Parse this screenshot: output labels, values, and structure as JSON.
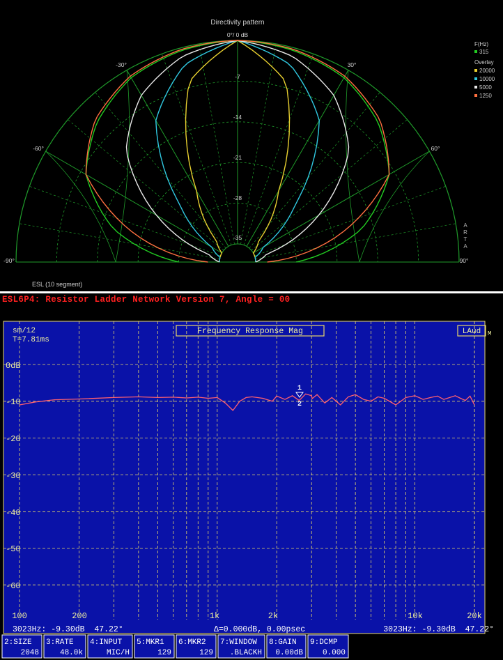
{
  "colors": {
    "polar_grid": "#1f9b2a",
    "fr_background": "#0a12a8",
    "fr_grid": "#e8d86a",
    "fr_trace": "#ff6070",
    "header_text": "#ff2020"
  },
  "polar": {
    "title": "Directivity pattern",
    "top_label": "0°/ 0 dB",
    "bottom_left_label": "ESL (10 segment)",
    "watermark": "ARTA",
    "radial_ticks": [
      "-7",
      "-14",
      "-21",
      "-28",
      "-35"
    ],
    "angle_labels": {
      "neg30": "-30°",
      "pos30": "30°",
      "neg60": "-60°",
      "pos60": "60°",
      "neg90": "-90°",
      "pos90": "90°"
    },
    "legend": {
      "freq_header": "F(Hz)",
      "main": {
        "label": "315",
        "color": "#22cc22"
      },
      "overlay_header": "Overlay",
      "overlays": [
        {
          "label": "20000",
          "color": "#e8d030"
        },
        {
          "label": "10000",
          "color": "#30c8e0"
        },
        {
          "label": "5000",
          "color": "#e8e8e8"
        },
        {
          "label": "1250",
          "color": "#ff7040"
        }
      ]
    }
  },
  "chart_data": [
    {
      "type": "line",
      "title": "Directivity pattern",
      "angle_range_deg": [
        -90,
        90
      ],
      "rlim_db": [
        -35,
        0
      ],
      "radial_ticks_db": [
        0,
        -7,
        -14,
        -21,
        -28,
        -35
      ],
      "angles_deg": [
        0,
        15,
        30,
        45,
        60,
        75,
        90
      ],
      "series": [
        {
          "name": "315",
          "values_db": [
            0,
            -0.5,
            -1.5,
            -4,
            -8,
            -16,
            -28
          ],
          "symmetric": true
        },
        {
          "name": "20000",
          "values_db": [
            0,
            -6,
            -24,
            -33,
            -35,
            -35,
            -35
          ],
          "symmetric": true
        },
        {
          "name": "10000",
          "values_db": [
            0,
            -3,
            -10,
            -24,
            -33,
            -35,
            -35
          ],
          "symmetric": true
        },
        {
          "name": "5000",
          "values_db": [
            0,
            -1.5,
            -5,
            -11,
            -22,
            -33,
            -35
          ],
          "symmetric": true
        },
        {
          "name": "1250",
          "values_db": [
            0,
            -0.3,
            -1.2,
            -3.5,
            -8,
            -20,
            -33
          ],
          "symmetric": true
        }
      ]
    },
    {
      "type": "line",
      "title": "Frequency Response Mag",
      "xscale": "log",
      "xlim": [
        100,
        20000
      ],
      "ylim": [
        -70,
        0
      ],
      "x_ticks": [
        "100",
        "200",
        "1k",
        "2k",
        "10k",
        "20k"
      ],
      "y_ticks": [
        "0dB",
        "-10",
        "-20",
        "-30",
        "-40",
        "-50",
        "-60"
      ],
      "series": [
        {
          "x": [
            100,
            120,
            150,
            200,
            300,
            400,
            500,
            600,
            700,
            800,
            900,
            1000,
            1100,
            1200,
            1300,
            1400,
            1500,
            1700,
            1900,
            2000,
            2200,
            2400,
            2600,
            2800,
            3000,
            3023,
            3200,
            3500,
            3800,
            4200,
            4600,
            5000,
            5500,
            6000,
            6500,
            7000,
            8000,
            9000,
            10000,
            11000,
            12000,
            13000,
            14000,
            15000,
            16000,
            17000,
            18000,
            19000,
            20000
          ],
          "y": [
            -11,
            -10.2,
            -9.6,
            -9.4,
            -9,
            -8.8,
            -9,
            -8.9,
            -9.1,
            -8.9,
            -9.2,
            -9,
            -10.5,
            -12.5,
            -10,
            -9,
            -8.8,
            -9.2,
            -10,
            -8.6,
            -9.5,
            -8.5,
            -9.8,
            -8,
            -8.5,
            -9.3,
            -8.2,
            -10.5,
            -9,
            -11,
            -8.8,
            -8.2,
            -9.5,
            -10,
            -8.8,
            -9.2,
            -11,
            -9,
            -8.5,
            -9.5,
            -9,
            -8.6,
            -9.5,
            -9,
            -8.5,
            -9.2,
            -9.8,
            -8.6,
            -11
          ]
        }
      ]
    }
  ],
  "fr": {
    "header": "ESL6P4: Resistor Ladder Network Version 7, Angle = 00",
    "smoothing": "sm/12",
    "time": "T=7.81ms",
    "title_box": "Frequency Response Mag",
    "laud": "LAud",
    "laud_suffix": "M",
    "y_labels": [
      "0dB",
      "-10",
      "-20",
      "-30",
      "-40",
      "-50",
      "-60"
    ],
    "x_labels": [
      "100",
      "200",
      "1k",
      "2k",
      "10k",
      "20k"
    ],
    "marker1": "1",
    "marker2": "2",
    "status_left": "3023Hz: -9.30dB  47.22°",
    "status_mid": "Δ=0.000dB, 0.00psec",
    "status_right": "3023Hz: -9.30dB  47.22°",
    "softkeys": [
      {
        "top": "2:SIZE",
        "bottom": "2048"
      },
      {
        "top": "3:RATE",
        "bottom": "48.0k"
      },
      {
        "top": "4:INPUT",
        "bottom": "MIC/H"
      },
      {
        "top": "5:MKR1",
        "bottom": "129"
      },
      {
        "top": "6:MKR2",
        "bottom": "129"
      },
      {
        "top": "7:WINDOW",
        "bottom": ".BLACKH"
      },
      {
        "top": "8:GAIN",
        "bottom": "0.00dB"
      },
      {
        "top": "9:DCMP",
        "bottom": "0.000"
      }
    ]
  }
}
